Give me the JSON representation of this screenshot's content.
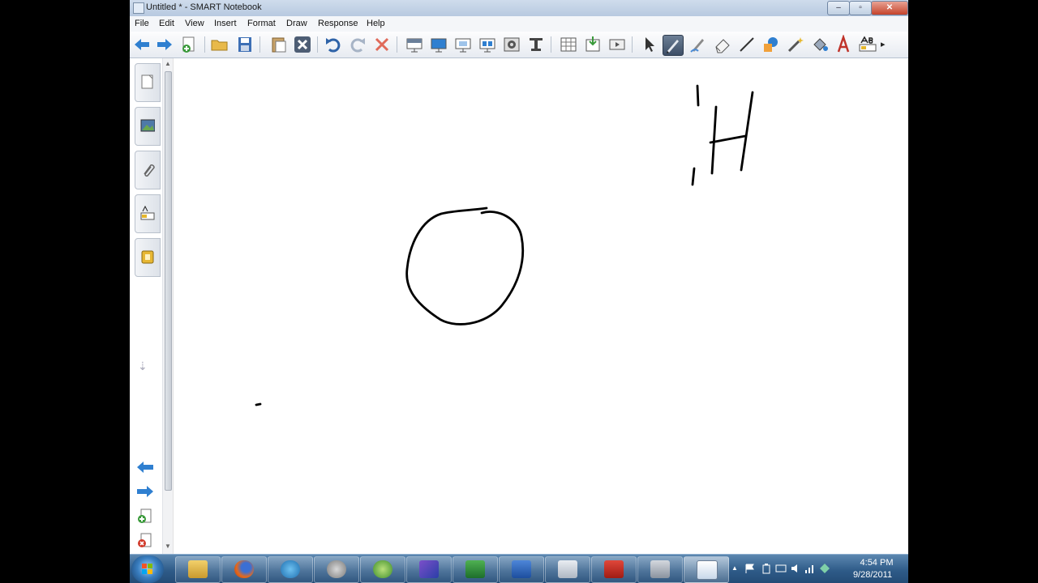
{
  "window": {
    "title": "Untitled * - SMART Notebook",
    "min_glyph": "–",
    "max_glyph": "▫",
    "close_glyph": "✕"
  },
  "menu": {
    "file": "File",
    "edit": "Edit",
    "view": "View",
    "insert": "Insert",
    "format": "Format",
    "draw": "Draw",
    "response": "Response",
    "help": "Help"
  },
  "toolbar": {
    "tools": [
      "back-icon",
      "forward-icon",
      "add-page-icon",
      "open-file-icon",
      "save-icon",
      "paste-icon",
      "delete-icon",
      "undo-icon",
      "redo-icon",
      "clear-icon",
      "screen-shade-icon",
      "full-screen-icon",
      "dual-display-icon",
      "display-icon",
      "screen-capture-icon",
      "document-camera-icon",
      "table-icon",
      "insert-icon",
      "video-icon",
      "select-icon",
      "pen-icon",
      "creative-pen-icon",
      "eraser-icon",
      "line-icon",
      "shapes-icon",
      "magic-pen-icon",
      "fill-icon",
      "text-icon",
      "properties-icon"
    ],
    "active_tool": "pen-icon",
    "more_glyph": "▸"
  },
  "sidebar": {
    "tabs": [
      "page-sorter-icon",
      "gallery-icon",
      "attachments-icon",
      "properties-icon",
      "addons-icon"
    ],
    "down_glyph": "⇣"
  },
  "colors": {
    "ink": "#000000",
    "taskbar": "#2e5b88",
    "active_tool": "#3d4e66"
  },
  "taskbar": {
    "apps": [
      "windows-explorer-icon",
      "firefox-icon",
      "network-icon",
      "globe-icon",
      "smart-tools-icon",
      "visual-studio-icon",
      "excel-icon",
      "word-icon",
      "calculator-icon",
      "acrobat-icon",
      "notebook-files-icon",
      "smart-notebook-icon"
    ],
    "time": "4:54 PM",
    "date": "9/28/2011",
    "tray_arrow": "▲"
  }
}
